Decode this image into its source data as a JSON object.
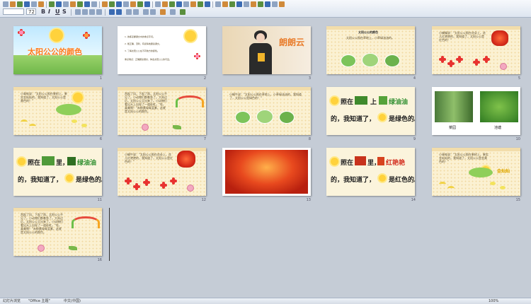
{
  "toolbar": {
    "font_size": "72",
    "row1_buttons": 38,
    "row2_glyphs": [
      "B",
      "I",
      "U",
      "S",
      "A",
      "A"
    ]
  },
  "slides": [
    {
      "num": "1",
      "title": "太阳公公的颜色"
    },
    {
      "num": "2",
      "lines": [
        "1. 熟练掌握课文中的重点字词。",
        "2. 能正确、流利、有感情地朗读课文。",
        "3. 了解太阳公公在不同地方的颜色。",
        "重点难点：正确朗读课文，体会太阳公公的可爱。"
      ]
    },
    {
      "num": "3",
      "logo": "朗朗云"
    },
    {
      "num": "4",
      "heading": "太阳公公的颜色",
      "text": "太阳公公照在草地上，小草绿油油的。"
    },
    {
      "num": "5",
      "text": "小蝴蝶说：\"太阳公公照在花朵上，花儿红艳艳的，我知道了，太阳公公是红色的！\""
    },
    {
      "num": "6",
      "text": "小青蛙说：\"太阳公公照在果树上，果实金灿灿的，我知道了，太阳公公是黄色的！\""
    },
    {
      "num": "7",
      "text": "刮起了风，下起了雨，太阳公公不见了。小动物们都着急了。大雨过后，太阳公公又出来了。小动物们看见天上出现了一道彩虹。\"哇，真美啊！\"赤橙黄绿青蓝紫，这就是太阳公公的颜色。"
    },
    {
      "num": "8",
      "text": "小蜗牛说：\"太阳公公照在草地上，小草绿油油的，我知道了，太阳公公是绿色的！\""
    },
    {
      "num": "9",
      "pre": "照在",
      "mid": "上",
      "post": "绿油油",
      "line2": "的，我知道了，",
      "end": "是绿色的。"
    },
    {
      "num": "10",
      "captions": [
        "菜园",
        "池塘"
      ]
    },
    {
      "num": "11",
      "pre": "照在",
      "mid": "里，",
      "post": "绿油油",
      "line2": "的，我知道了，",
      "end": "是绿色的。"
    },
    {
      "num": "12",
      "text": "小蜗牛说：\"太阳公公照在花朵上，花儿红艳艳的，我知道了，太阳公公是红色的！\""
    },
    {
      "num": "13"
    },
    {
      "num": "14",
      "pre": "照在",
      "mid": "里，",
      "post": "红艳艳",
      "line2": "的，我知道了，",
      "end": "是红色的。"
    },
    {
      "num": "15",
      "text": "小青蛙说：\"太阳公公照在果树上，果实金灿灿的，我知道了，太阳公公是金黄色的！\"",
      "tag": "金灿灿"
    },
    {
      "num": "16",
      "text": "刮起了风，下起了雨，太阳公公不见了。小动物们都着急了。大雨过后，太阳公公又出来了。小动物们看见天上出现了一道彩虹。\"哇，真美啊！\"赤橙黄绿青蓝紫，这就是太阳公公的颜色。"
    }
  ],
  "status": {
    "left": "幻灯片浏览",
    "mid": "\"Office 主题\"",
    "lang": "中文(中国)",
    "zoom": "100%"
  }
}
